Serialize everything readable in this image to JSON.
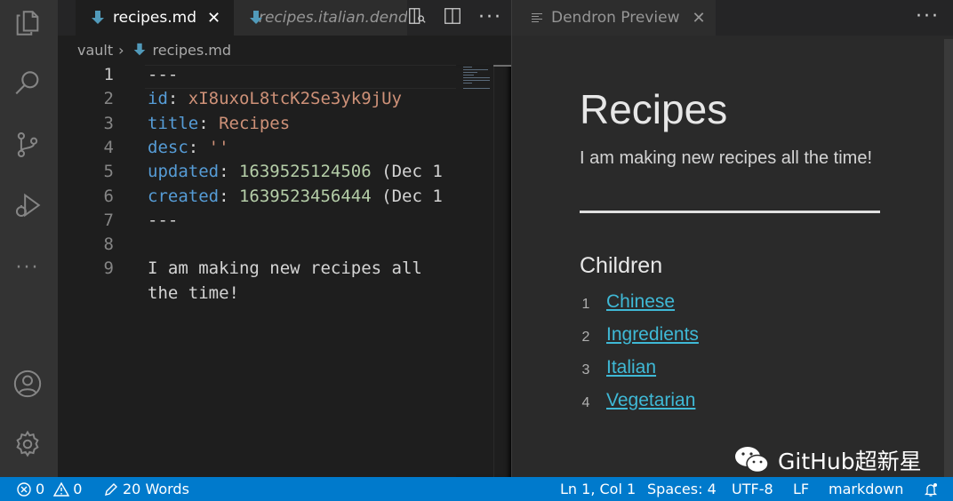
{
  "activity_bar": {
    "items": [
      "explorer-icon",
      "search-icon",
      "source-control-icon",
      "run-debug-icon",
      "more-icon",
      "account-icon",
      "settings-gear-icon"
    ]
  },
  "editor": {
    "tabs": [
      {
        "label": "recipes.md",
        "active": true,
        "close": "✕"
      },
      {
        "label": "recipes.italian.dendron.md",
        "active": false
      }
    ],
    "actions": [
      "open-preview-icon",
      "split-editor-icon",
      "more-actions-icon"
    ],
    "more_label": "···",
    "breadcrumb": {
      "root": "vault",
      "separator": "›",
      "file": "recipes.md"
    },
    "lines": [
      {
        "num": "1",
        "parts": [
          {
            "t": "---",
            "c": "p"
          }
        ]
      },
      {
        "num": "2",
        "parts": [
          {
            "t": "id",
            "c": "k"
          },
          {
            "t": ": ",
            "c": "p"
          },
          {
            "t": "xI8uxoL8tcK2Se3yk9jUy",
            "c": "s"
          }
        ]
      },
      {
        "num": "3",
        "parts": [
          {
            "t": "title",
            "c": "k"
          },
          {
            "t": ": ",
            "c": "p"
          },
          {
            "t": "Recipes",
            "c": "s"
          }
        ]
      },
      {
        "num": "4",
        "parts": [
          {
            "t": "desc",
            "c": "k"
          },
          {
            "t": ": ",
            "c": "p"
          },
          {
            "t": "''",
            "c": "s"
          }
        ]
      },
      {
        "num": "5",
        "parts": [
          {
            "t": "updated",
            "c": "k"
          },
          {
            "t": ": ",
            "c": "p"
          },
          {
            "t": "1639525124506",
            "c": "n"
          },
          {
            "t": " (Dec 1",
            "c": "p"
          }
        ]
      },
      {
        "num": "6",
        "parts": [
          {
            "t": "created",
            "c": "k"
          },
          {
            "t": ": ",
            "c": "p"
          },
          {
            "t": "1639523456444",
            "c": "n"
          },
          {
            "t": " (Dec 1",
            "c": "p"
          }
        ]
      },
      {
        "num": "7",
        "parts": [
          {
            "t": "---",
            "c": "p"
          }
        ]
      },
      {
        "num": "8",
        "parts": []
      },
      {
        "num": "9",
        "parts": [
          {
            "t": "I am making new recipes all",
            "c": "p"
          }
        ]
      },
      {
        "num": "",
        "parts": [
          {
            "t": "the time!",
            "c": "p"
          }
        ]
      }
    ]
  },
  "preview": {
    "tab_label": "Dendron Preview",
    "tab_close": "✕",
    "more_label": "···",
    "title": "Recipes",
    "body": "I am making new recipes all the time!",
    "children_heading": "Children",
    "children": [
      {
        "num": "1",
        "label": "Chinese"
      },
      {
        "num": "2",
        "label": "Ingredients"
      },
      {
        "num": "3",
        "label": "Italian"
      },
      {
        "num": "4",
        "label": "Vegetarian"
      }
    ]
  },
  "watermark": {
    "text": "GitHub超新星"
  },
  "status_bar": {
    "errors": "0",
    "warnings": "0",
    "words": "20 Words",
    "position": "Ln 1, Col 1",
    "spaces": "Spaces: 4",
    "encoding": "UTF-8",
    "eol": "LF",
    "language": "markdown",
    "color": "#007acc"
  }
}
